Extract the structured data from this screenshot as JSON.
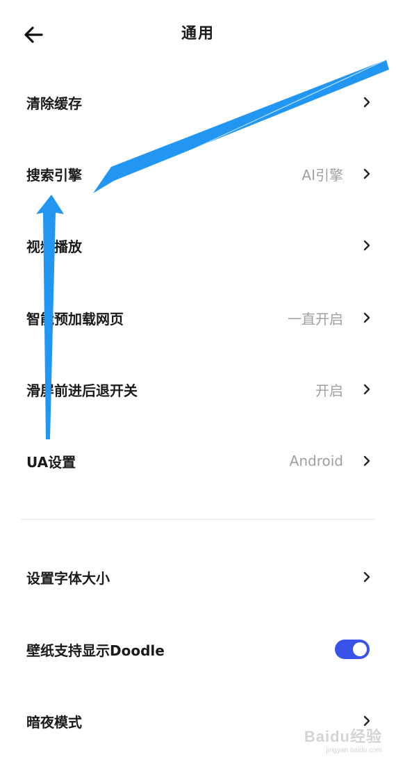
{
  "header": {
    "title": "通用",
    "back_icon": "arrow-left-icon"
  },
  "settings": [
    {
      "label": "清除缓存",
      "value": ""
    },
    {
      "label": "搜索引擎",
      "value": "AI引擎"
    },
    {
      "label": "视频播放",
      "value": ""
    },
    {
      "label": "智能预加载网页",
      "value": "一直开启"
    },
    {
      "label": "滑屏前进后退开关",
      "value": "开启"
    },
    {
      "label": "UA设置",
      "value": "Android"
    }
  ],
  "display": {
    "font_size_label": "设置字体大小",
    "doodle_label": "壁纸支持显示Doodle",
    "doodle_enabled": true,
    "night_mode_label": "暗夜模式"
  },
  "colors": {
    "toggle_on": "#3a52e8",
    "annotation_arrow": "#2196f3"
  },
  "watermark": {
    "main": "Baidu经验",
    "sub": "jingyan.baidu.com"
  }
}
